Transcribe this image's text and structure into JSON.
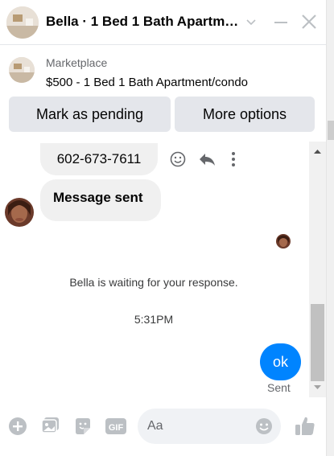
{
  "header": {
    "title": "Bella · 1 Bed 1 Bath Apartm…",
    "thumb_icon": "apartment-photo",
    "chevron_icon": "chevron-down-icon",
    "minimize_icon": "minimize-icon",
    "close_icon": "close-icon"
  },
  "listing": {
    "label": "Marketplace",
    "price_title": "$500 - 1 Bed 1 Bath Apartment/condo",
    "buttons": {
      "pending": "Mark as pending",
      "more": "More options"
    }
  },
  "conversation": {
    "phone_bubble": "602-673-7611",
    "message_bubble": "Message sent",
    "waiting_status": "Bella is waiting for your response.",
    "timestamp": "5:31PM",
    "outgoing_bubble": "ok",
    "sent_label": "Sent",
    "action_icons": [
      "emoji-react-icon",
      "reply-icon",
      "more-vertical-icon"
    ]
  },
  "composer": {
    "placeholder": "Aa",
    "icons": [
      "plus-icon",
      "image-icon",
      "sticker-icon",
      "gif-icon",
      "emoji-icon",
      "thumbs-up-icon"
    ]
  },
  "colors": {
    "accent_blue": "#0084ff",
    "icon_gray": "#bcc0c4",
    "button_gray": "#e4e6eb"
  }
}
